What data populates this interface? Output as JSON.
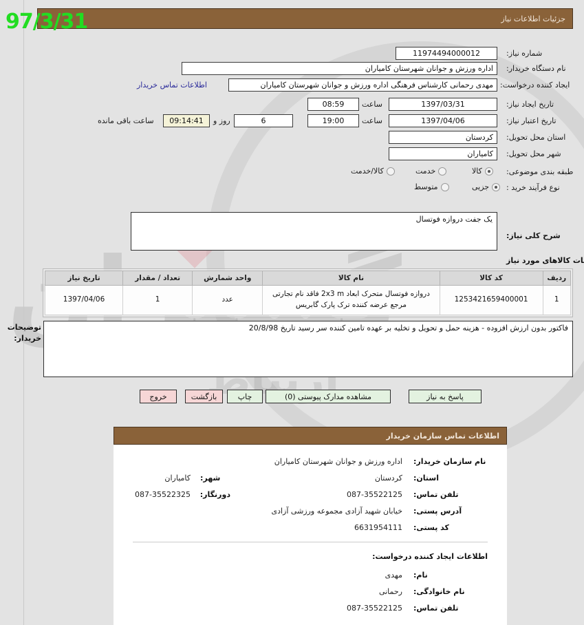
{
  "overlay": {
    "date_stamp": "97/3/31"
  },
  "watermark": {
    "main": "گستران",
    "sub": "ارتباط"
  },
  "header": {
    "title": "جزئیات اطلاعات نیاز"
  },
  "form": {
    "need_number_label": "شماره نیاز:",
    "need_number_value": "11974494000012",
    "buyer_org_label": "نام دستگاه خریدار:",
    "buyer_org_value": "اداره ورزش و جوانان شهرستان کامیاران",
    "requester_label": "ایجاد کننده درخواست:",
    "requester_value": "مهدی رحمانی کارشناس فرهنگی اداره ورزش و جوانان شهرستان کامیاران",
    "buyer_contact_link": "اطلاعات تماس خریدار",
    "create_date_label": "تاریخ ایجاد نیاز:",
    "create_date_value": "1397/03/31",
    "create_time_label": "ساعت",
    "create_time_value": "08:59",
    "expire_date_label": "تاریخ اعتبار نیاز:",
    "expire_date_value": "1397/04/06",
    "expire_time_label": "ساعت",
    "expire_time_value": "19:00",
    "days_value": "6",
    "days_label": "روز و",
    "countdown_value": "09:14:41",
    "countdown_label": "ساعت باقی مانده",
    "province_label": "استان محل تحویل:",
    "province_value": "کردستان",
    "city_label": "شهر محل تحویل:",
    "city_value": "کامیاران",
    "category_label": "طبقه بندی موضوعی:",
    "category_options": [
      {
        "label": "کالا",
        "checked": true
      },
      {
        "label": "خدمت",
        "checked": false
      },
      {
        "label": "کالا/خدمت",
        "checked": false
      }
    ],
    "process_label": "نوع فرآیند خرید :",
    "process_options": [
      {
        "label": "جزیی",
        "checked": true
      },
      {
        "label": "متوسط",
        "checked": false
      }
    ],
    "summary_label": "شرح کلی نیاز:",
    "summary_value": "یک جفت دروازه فوتسال"
  },
  "goods_section": {
    "heading": "اطلاعات کالاهای مورد نیاز",
    "columns": [
      "ردیف",
      "کد کالا",
      "نام کالا",
      "واحد شمارش",
      "تعداد / مقدار",
      "تاریخ نیاز"
    ],
    "rows": [
      {
        "row": "1",
        "code": "1253421659400001",
        "name": "دروازه فوتسال متحرک ابعاد 2x3 m فاقد نام تجارتی مرجع عرضه کننده ترک پارک گابریس",
        "unit": "عدد",
        "qty": "1",
        "need_date": "1397/04/06"
      }
    ]
  },
  "notes": {
    "label": "توضیحات خریدار:",
    "value": "فاکتور بدون ارزش افزوده - هزینه حمل  و تحویل و تخلیه بر عهده تامین کننده سر رسید تاریخ 20/8/98"
  },
  "buttons": [
    {
      "name": "respond",
      "label": "پاسخ به نیاز",
      "style": "green"
    },
    {
      "name": "view-attachments",
      "label": "مشاهده مدارک پیوستی (0)",
      "style": "green"
    },
    {
      "name": "print",
      "label": "چاپ",
      "style": "green"
    },
    {
      "name": "back",
      "label": "بازگشت",
      "style": "pink"
    },
    {
      "name": "exit",
      "label": "خروج",
      "style": "pink"
    }
  ],
  "contact": {
    "title": "اطلاعات تماس سازمان خریدار",
    "org_label": "نام سازمان خریدار:",
    "org_value": "اداره ورزش و جوانان شهرستان کامیاران",
    "province_label": "استان:",
    "province_value": "کردستان",
    "city_label": "شهر:",
    "city_value": "کامیاران",
    "phone_label": "تلفن تماس:",
    "phone_value": "087-35522125",
    "fax_label": "دورنگار:",
    "fax_value": "087-35522325",
    "address_label": "آدرس پستی:",
    "address_value": "خیابان شهید آزادی مجموعه ورزشی آزادی",
    "postal_label": "کد پستی:",
    "postal_value": "6631954111",
    "requester_heading": "اطلاعات ایجاد کننده درخواست:",
    "first_name_label": "نام:",
    "first_name_value": "مهدی",
    "last_name_label": "نام خانوادگی:",
    "last_name_value": "رحمانی",
    "req_phone_label": "تلفن تماس:",
    "req_phone_value": "087-35522125"
  },
  "colors": {
    "header_bar": "#8a6239",
    "page_bg": "#e3e3e3",
    "link": "#2a2a9a",
    "stamp_green": "#22dd22",
    "btn_green": "#e3f2e0",
    "btn_pink": "#f6d6d6"
  }
}
